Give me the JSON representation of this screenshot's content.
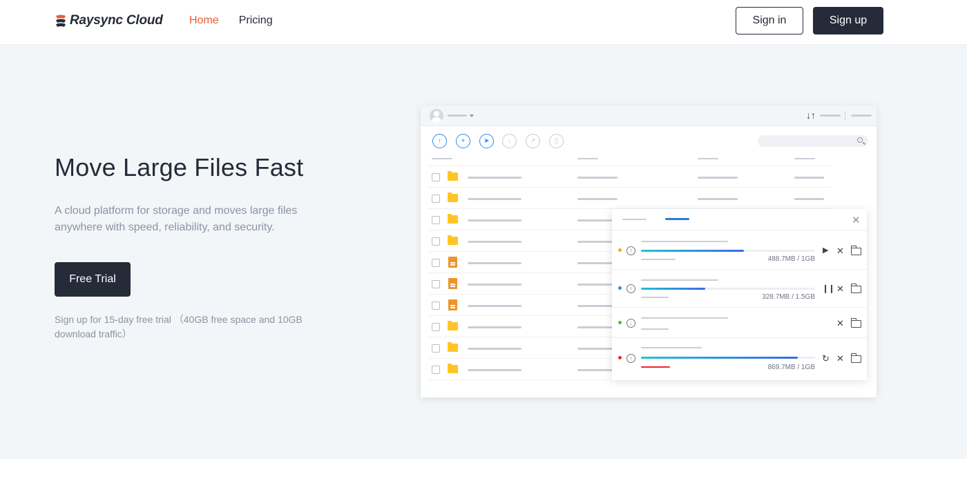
{
  "brand": {
    "name": "Raysync Cloud"
  },
  "nav": {
    "home": "Home",
    "pricing": "Pricing"
  },
  "auth": {
    "signin": "Sign in",
    "signup": "Sign up"
  },
  "hero": {
    "title": "Move Large Files Fast",
    "description": "A cloud platform for storage and moves large files anywhere with speed, reliability, and security.",
    "cta": "Free Trial",
    "note": "Sign up for 15-day free trial （40GB free space and 10GB download traffic）"
  },
  "colors": {
    "accent": "#ec5b2f",
    "dark": "#262b3a",
    "hero_bg": "#f2f6f8",
    "progress": "#2a8de8"
  },
  "app_mock": {
    "toolbar_icons": [
      "upload-icon",
      "new-folder-icon",
      "send-icon",
      "download-icon",
      "share-icon",
      "delete-icon"
    ],
    "rows": [
      "folder",
      "folder",
      "folder",
      "folder",
      "document",
      "document",
      "document",
      "folder",
      "folder",
      "folder"
    ],
    "transfers": [
      {
        "status_color": "#f5a623",
        "direction": "upload",
        "progress": 0.59,
        "size": "488.7MB / 1GB",
        "action": "play"
      },
      {
        "status_color": "#2a8de8",
        "direction": "upload",
        "progress": 0.37,
        "size": "328.7MB / 1.5GB",
        "action": "pause"
      },
      {
        "status_color": "#52c41a",
        "direction": "download",
        "progress": 0,
        "size": "",
        "action": "none"
      },
      {
        "status_color": "#f5222d",
        "direction": "upload",
        "progress": 0.9,
        "size": "869.7MB / 1GB",
        "action": "retry"
      }
    ]
  }
}
